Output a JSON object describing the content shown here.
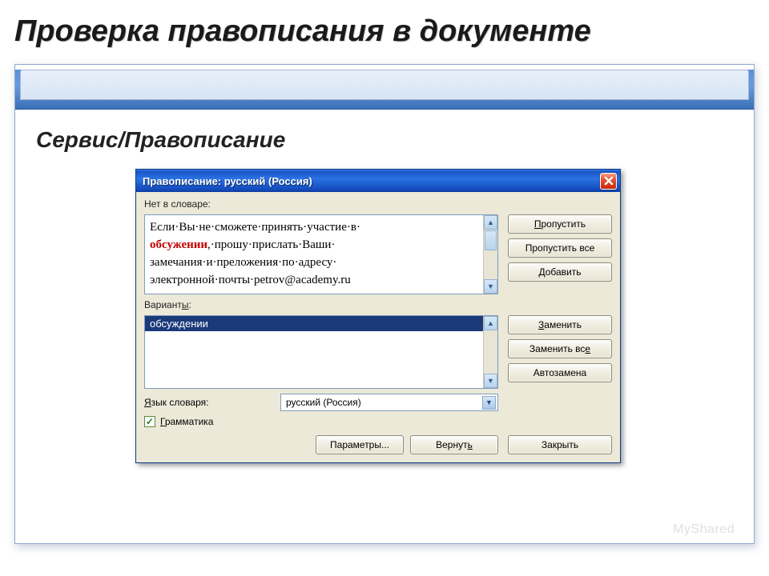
{
  "slide": {
    "title": "Проверка правописания в документе",
    "menu_path": "Сервис/Правописание",
    "watermark": "MyShared"
  },
  "dialog": {
    "title": "Правописание: русский (Россия)",
    "not_in_dict_label": "Нет в словаре:",
    "text_pre": "Если·Вы·не·сможете·принять·участие·в·",
    "text_error": "обсужении",
    "text_post1": ",·прошу·прислать·Ваши·",
    "text_post2": "замечания·и·преложения·по·адресу·",
    "text_post3": "электронной·почты·petrov@academy.ru",
    "variants_label": "Варианты:",
    "variant": "обсуждении",
    "lang_label": "Язык словаря:",
    "lang_value": "русский (Россия)",
    "grammar_label": "Грамматика",
    "buttons": {
      "skip": "Пропустить",
      "skip_all": "Пропустить все",
      "add": "Добавить",
      "replace": "Заменить",
      "replace_all": "Заменить все",
      "autoreplace": "Автозамена",
      "options": "Параметры...",
      "undo": "Вернуть",
      "close": "Закрыть"
    }
  }
}
